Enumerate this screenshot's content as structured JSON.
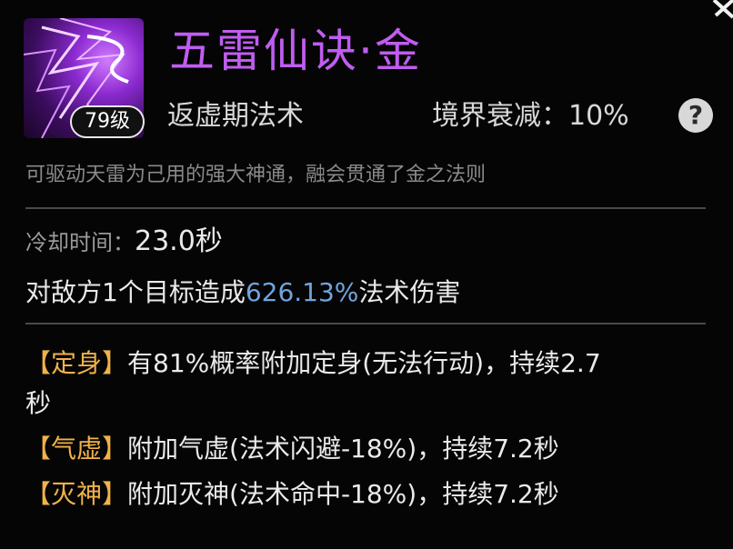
{
  "skill": {
    "name": "五雷仙诀·金",
    "level_badge": "79级",
    "realm_type": "返虚期法术",
    "decay_label": "境界衰减：",
    "decay_value": "10%",
    "help_glyph": "?",
    "description": "可驱动天雷为己用的强大神通，融会贯通了金之法则",
    "icon": "purple-lightning-skill-icon"
  },
  "stats": {
    "cooldown_label": "冷却时间：",
    "cooldown_value": "23.0秒",
    "damage_prefix": "对敌方1个目标造成",
    "damage_value": "626.13%",
    "damage_suffix": "法术伤害"
  },
  "effects": [
    {
      "tag": "【定身】",
      "text": "有81%概率附加定身(无法行动)，持续2.7",
      "text2": "秒"
    },
    {
      "tag": "【气虚】",
      "text": "附加气虚(法术闪避-18%)，持续7.2秒"
    },
    {
      "tag": "【灭神】",
      "text": "附加灭神(法术命中-18%)，持续7.2秒"
    }
  ],
  "colors": {
    "skill_name": "#c05df0",
    "damage_highlight": "#6fa5dd",
    "effect_tag": "#f0b24a"
  }
}
